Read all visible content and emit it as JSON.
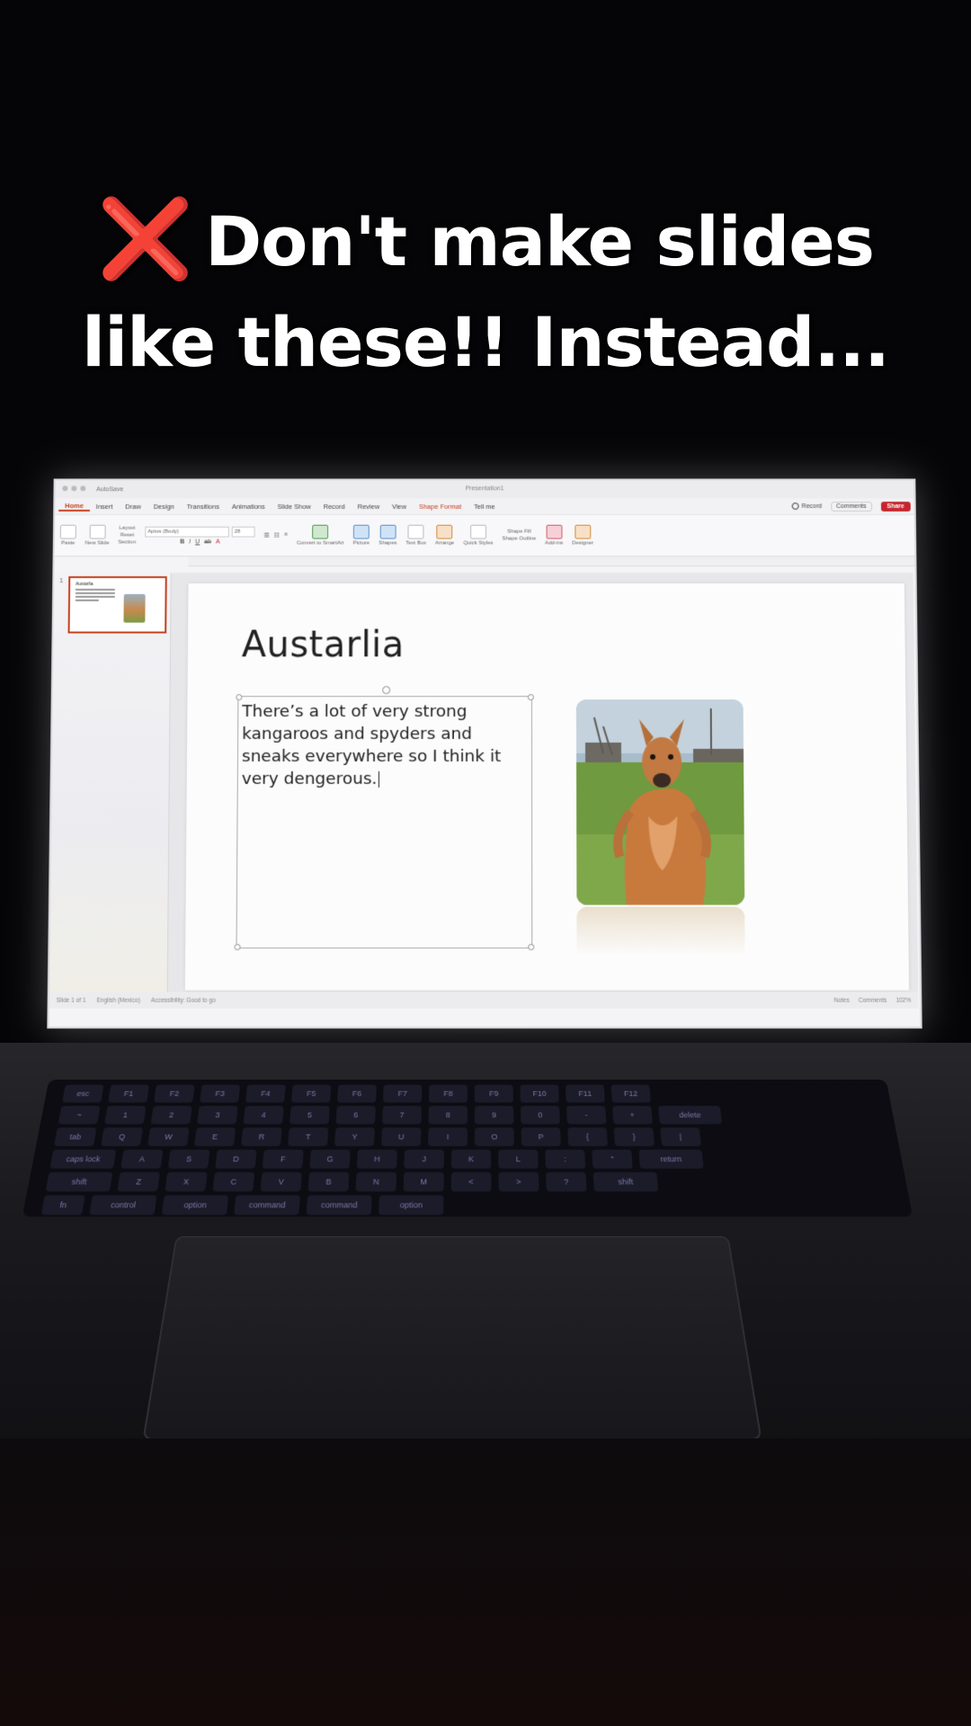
{
  "caption": {
    "mark": "❌",
    "line1": "Don't make slides",
    "line2": "like these!! Instead..."
  },
  "app": {
    "title": "Presentation1",
    "autosave": "AutoSave",
    "tabs": [
      "Home",
      "Insert",
      "Draw",
      "Design",
      "Transitions",
      "Animations",
      "Slide Show",
      "Record",
      "Review",
      "View",
      "Shape Format",
      "Tell me"
    ],
    "record_label": "Record",
    "comments_label": "Comments",
    "share_label": "Share"
  },
  "ribbon": {
    "paste": "Paste",
    "new_slide": "New Slide",
    "layout": "Layout",
    "reset": "Reset",
    "section": "Section",
    "font": "Aptos (Body)",
    "font_size": "28",
    "convert": "Convert to SmartArt",
    "picture": "Picture",
    "shapes": "Shapes",
    "text_box": "Text Box",
    "arrange": "Arrange",
    "quick_styles": "Quick Styles",
    "shape_fill": "Shape Fill",
    "shape_outline": "Shape Outline",
    "add_ins": "Add-ins",
    "designer": "Designer"
  },
  "thumbnail": {
    "number": "1",
    "title": "Austarlia"
  },
  "slide": {
    "title": "Austarlia",
    "body": "There’s a lot of very strong kangaroos and spyders and sneaks everywhere so I think it very dengerous."
  },
  "status": {
    "slide_count": "Slide 1 of 1",
    "language": "English (Mexico)",
    "accessibility": "Accessibility: Good to go",
    "notes": "Notes",
    "comments": "Comments",
    "zoom": "102%"
  },
  "keyboard": {
    "row1": [
      "esc",
      "F1",
      "F2",
      "F3",
      "F4",
      "F5",
      "F6",
      "F7",
      "F8",
      "F9",
      "F10",
      "F11",
      "F12"
    ],
    "row2": [
      "~",
      "1",
      "2",
      "3",
      "4",
      "5",
      "6",
      "7",
      "8",
      "9",
      "0",
      "-",
      "+",
      "delete"
    ],
    "row3": [
      "tab",
      "Q",
      "W",
      "E",
      "R",
      "T",
      "Y",
      "U",
      "I",
      "O",
      "P",
      "{",
      "}",
      "|"
    ],
    "row4": [
      "caps lock",
      "A",
      "S",
      "D",
      "F",
      "G",
      "H",
      "J",
      "K",
      "L",
      ":",
      "\"",
      "return"
    ],
    "row5": [
      "shift",
      "Z",
      "X",
      "C",
      "V",
      "B",
      "N",
      "M",
      "<",
      ">",
      "?",
      "shift"
    ],
    "row6": [
      "fn",
      "control",
      "option",
      "command",
      "command",
      "option"
    ]
  },
  "colors": {
    "accent": "#c43e1c",
    "share": "#c4262e",
    "caption_mark": "#e4141b"
  }
}
